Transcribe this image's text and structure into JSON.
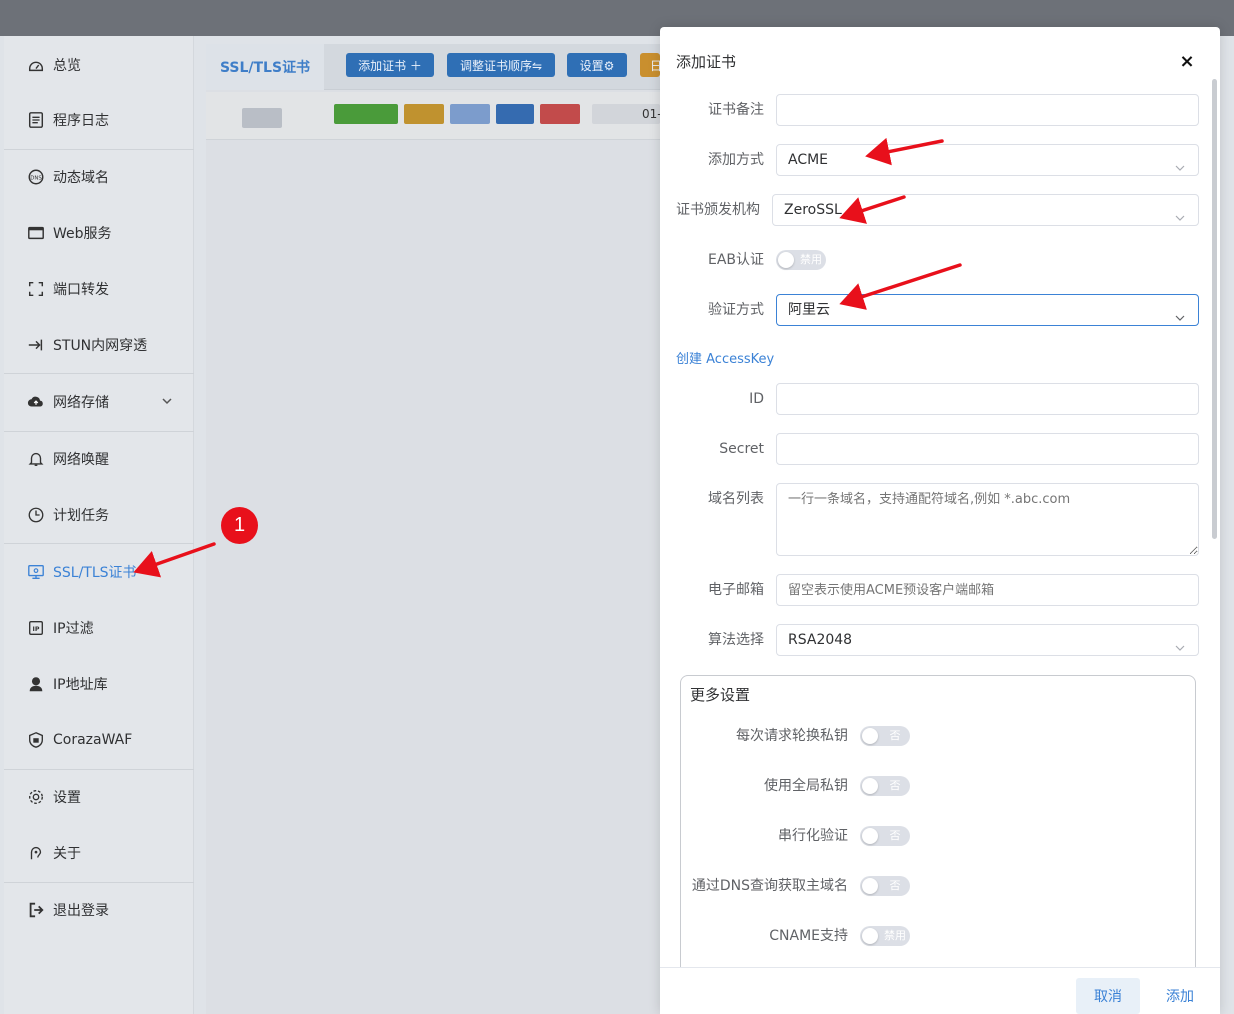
{
  "sidebar": {
    "items": [
      {
        "label": "总览",
        "icon": "dashboard-icon"
      },
      {
        "label": "程序日志",
        "icon": "log-icon"
      },
      {
        "label": "动态域名",
        "icon": "dns-icon"
      },
      {
        "label": "Web服务",
        "icon": "web-icon"
      },
      {
        "label": "端口转发",
        "icon": "port-forward-icon"
      },
      {
        "label": "STUN内网穿透",
        "icon": "stun-icon"
      },
      {
        "label": "网络存储",
        "icon": "cloud-storage-icon"
      },
      {
        "label": "网络唤醒",
        "icon": "bell-icon"
      },
      {
        "label": "计划任务",
        "icon": "clock-icon"
      },
      {
        "label": "SSL/TLS证书",
        "icon": "certificate-icon"
      },
      {
        "label": "IP过滤",
        "icon": "ip-filter-icon"
      },
      {
        "label": "IP地址库",
        "icon": "ip-database-icon"
      },
      {
        "label": "CorazaWAF",
        "icon": "shield-icon"
      },
      {
        "label": "设置",
        "icon": "gear-icon"
      },
      {
        "label": "关于",
        "icon": "about-icon"
      },
      {
        "label": "退出登录",
        "icon": "logout-icon"
      }
    ]
  },
  "content": {
    "tab": "SSL/TLS证书",
    "buttons": {
      "add": "添加证书 ＋",
      "reorder": "调整证书顺序⇋",
      "settings": "设置⚙",
      "extra": "日"
    },
    "row_fragment": "01-"
  },
  "dialog": {
    "title": "添加证书",
    "close": "×",
    "fields": {
      "remark": {
        "label": "证书备注",
        "value": ""
      },
      "add_method": {
        "label": "添加方式",
        "value": "ACME"
      },
      "issuer": {
        "label": "证书颁发机构",
        "value": "ZeroSSL"
      },
      "eab": {
        "label": "EAB认证",
        "switch": "禁用"
      },
      "verify": {
        "label": "验证方式",
        "value": "阿里云"
      },
      "id": {
        "label": "ID",
        "value": ""
      },
      "secret": {
        "label": "Secret",
        "value": ""
      },
      "domains": {
        "label": "域名列表",
        "placeholder": "一行一条域名，支持通配符域名,例如 *.abc.com"
      },
      "email": {
        "label": "电子邮箱",
        "placeholder": "留空表示使用ACME预设客户端邮箱"
      },
      "algorithm": {
        "label": "算法选择",
        "value": "RSA2048"
      }
    },
    "accesskey_link": "创建 AccessKey",
    "more": {
      "title": "更多设置",
      "items": [
        {
          "label": "每次请求轮换私钥",
          "switch": "否"
        },
        {
          "label": "使用全局私钥",
          "switch": "否"
        },
        {
          "label": "串行化验证",
          "switch": "否"
        },
        {
          "label": "通过DNS查询获取主域名",
          "switch": "否"
        },
        {
          "label": "CNAME支持",
          "switch": "禁用"
        }
      ]
    },
    "footer": {
      "cancel": "取消",
      "submit": "添加"
    }
  },
  "annotation": {
    "badge": "1",
    "color": "#e8101b"
  }
}
